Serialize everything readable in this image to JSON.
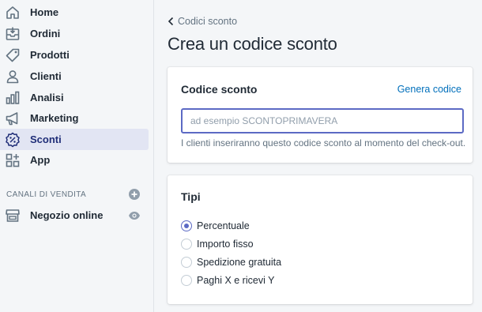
{
  "sidebar": {
    "items": [
      {
        "label": "Home",
        "icon": "home-icon"
      },
      {
        "label": "Ordini",
        "icon": "orders-icon"
      },
      {
        "label": "Prodotti",
        "icon": "tag-icon"
      },
      {
        "label": "Clienti",
        "icon": "person-icon"
      },
      {
        "label": "Analisi",
        "icon": "bar-chart-icon"
      },
      {
        "label": "Marketing",
        "icon": "megaphone-icon"
      },
      {
        "label": "Sconti",
        "icon": "discount-icon",
        "active": true
      },
      {
        "label": "App",
        "icon": "apps-icon"
      }
    ],
    "sales_channels_title": "CANALI DI VENDITA",
    "channels": [
      {
        "label": "Negozio online",
        "icon": "store-icon"
      }
    ]
  },
  "main": {
    "breadcrumb": "Codici sconto",
    "title": "Crea un codice sconto",
    "code_card": {
      "heading": "Codice sconto",
      "generate_link": "Genera codice",
      "input_value": "",
      "input_placeholder": "ad esempio SCONTOPRIMAVERA",
      "help_text": "I clienti inseriranno questo codice sconto al momento del check-out."
    },
    "types_card": {
      "heading": "Tipi",
      "options": [
        {
          "label": "Percentuale",
          "selected": true
        },
        {
          "label": "Importo fisso",
          "selected": false
        },
        {
          "label": "Spedizione gratuita",
          "selected": false
        },
        {
          "label": "Paghi X e ricevi Y",
          "selected": false
        }
      ]
    }
  },
  "colors": {
    "accent": "#5c6ac4",
    "link": "#006fbb",
    "active_bg": "#e2e5f3",
    "sidebar_bg": "#f4f6f8",
    "icon": "#637381"
  }
}
